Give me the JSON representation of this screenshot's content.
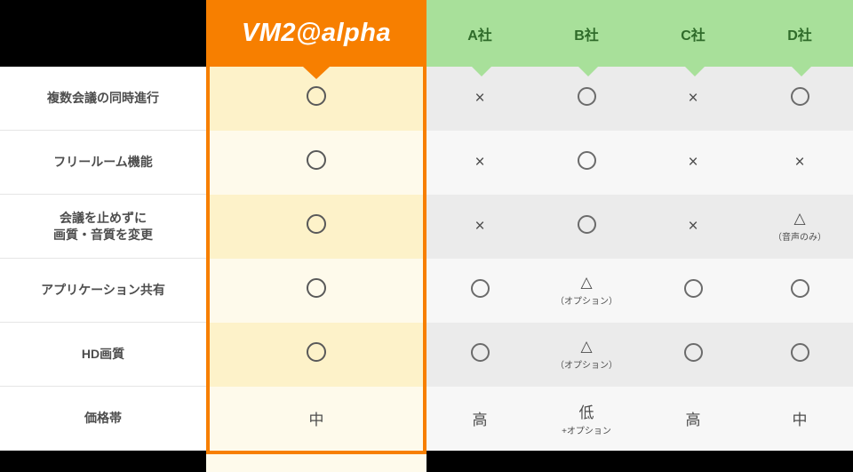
{
  "header": {
    "blank_label": "",
    "main_product": "VM2@alpha",
    "competitors": [
      "A社",
      "B社",
      "C社",
      "D社"
    ]
  },
  "marks": {
    "circle": "○",
    "cross": "×",
    "triangle": "△"
  },
  "rows": [
    {
      "label": "複数会議の同時進行",
      "label_line2": "",
      "main": {
        "type": "circle",
        "text": "",
        "sub": ""
      },
      "others": [
        {
          "type": "cross",
          "text": "",
          "sub": ""
        },
        {
          "type": "circle",
          "text": "",
          "sub": ""
        },
        {
          "type": "cross",
          "text": "",
          "sub": ""
        },
        {
          "type": "circle",
          "text": "",
          "sub": ""
        }
      ]
    },
    {
      "label": "フリールーム機能",
      "label_line2": "",
      "main": {
        "type": "circle",
        "text": "",
        "sub": ""
      },
      "others": [
        {
          "type": "cross",
          "text": "",
          "sub": ""
        },
        {
          "type": "circle",
          "text": "",
          "sub": ""
        },
        {
          "type": "cross",
          "text": "",
          "sub": ""
        },
        {
          "type": "cross",
          "text": "",
          "sub": ""
        }
      ]
    },
    {
      "label": "会議を止めずに",
      "label_line2": "画質・音質を変更",
      "main": {
        "type": "circle",
        "text": "",
        "sub": ""
      },
      "others": [
        {
          "type": "cross",
          "text": "",
          "sub": ""
        },
        {
          "type": "circle",
          "text": "",
          "sub": ""
        },
        {
          "type": "cross",
          "text": "",
          "sub": ""
        },
        {
          "type": "triangle",
          "text": "",
          "sub": "（音声のみ）"
        }
      ]
    },
    {
      "label": "アプリケーション共有",
      "label_line2": "",
      "main": {
        "type": "circle",
        "text": "",
        "sub": ""
      },
      "others": [
        {
          "type": "circle",
          "text": "",
          "sub": ""
        },
        {
          "type": "triangle",
          "text": "",
          "sub": "（オプション）"
        },
        {
          "type": "circle",
          "text": "",
          "sub": ""
        },
        {
          "type": "circle",
          "text": "",
          "sub": ""
        }
      ]
    },
    {
      "label": "HD画質",
      "label_line2": "",
      "main": {
        "type": "circle",
        "text": "",
        "sub": ""
      },
      "others": [
        {
          "type": "circle",
          "text": "",
          "sub": ""
        },
        {
          "type": "triangle",
          "text": "",
          "sub": "（オプション）"
        },
        {
          "type": "circle",
          "text": "",
          "sub": ""
        },
        {
          "type": "circle",
          "text": "",
          "sub": ""
        }
      ]
    },
    {
      "label": "価格帯",
      "label_line2": "",
      "main": {
        "type": "text",
        "text": "中",
        "sub": ""
      },
      "others": [
        {
          "type": "text",
          "text": "高",
          "sub": ""
        },
        {
          "type": "text",
          "text": "低",
          "sub": "+オプション"
        },
        {
          "type": "text",
          "text": "高",
          "sub": ""
        },
        {
          "type": "text",
          "text": "中",
          "sub": ""
        }
      ]
    }
  ],
  "colors": {
    "accent_orange": "#f77f00",
    "header_green": "#a8e09a",
    "green_text": "#2f6b2a",
    "main_cell_dark": "#fdf2c9",
    "main_cell_light": "#fefaeb",
    "other_cell_dark": "#ebebeb",
    "other_cell_light": "#f7f7f7",
    "background": "#000000"
  }
}
